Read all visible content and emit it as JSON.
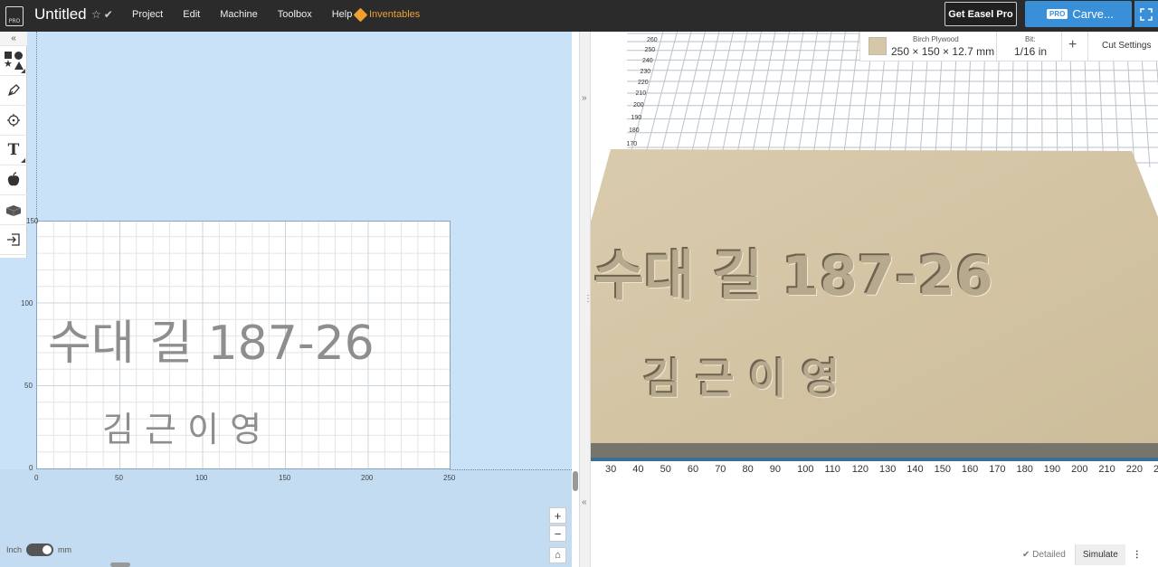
{
  "app": {
    "logo_text": "PRO",
    "title": "Untitled",
    "title_icons": "☆✔"
  },
  "menu": {
    "items": [
      "Project",
      "Edit",
      "Machine",
      "Toolbox",
      "Help"
    ],
    "inventables": "Inventables"
  },
  "actions": {
    "get_pro": "Get Easel Pro",
    "carve_badge": "PRO",
    "carve": "Carve...",
    "expand_icon": "expand-icon"
  },
  "toolbar": {
    "collapse": "«",
    "tools": [
      "shapes-icon",
      "pen-icon",
      "target-icon",
      "text-icon",
      "apple-icon",
      "box-icon",
      "import-icon"
    ],
    "text_tool": "T"
  },
  "canvas": {
    "y_ticks": [
      "150",
      "100",
      "50",
      "0"
    ],
    "x_ticks": [
      "0",
      "50",
      "100",
      "150",
      "200",
      "250"
    ],
    "line1": "수대   길 187-26",
    "line2": "김  근 이  영"
  },
  "units": {
    "left": "Inch",
    "right": "mm"
  },
  "zoom": {
    "in": "+",
    "out": "−",
    "home": "⌂"
  },
  "material": {
    "name": "Birch Plywood",
    "size": "250 × 150 × 12.7 mm",
    "bit_label": "Bit:",
    "bit_value": "1/16 in",
    "add": "+",
    "cut_settings": "Cut Settings"
  },
  "preview": {
    "line1": "수대   길 187-26",
    "line2": "김  근 이  영",
    "y_ticks": [
      "260",
      "250",
      "240",
      "230",
      "220",
      "210",
      "200",
      "190",
      "180",
      "170"
    ],
    "x_ticks": [
      "30",
      "40",
      "50",
      "60",
      "70",
      "80",
      "90",
      "100",
      "110",
      "120",
      "130",
      "140",
      "150",
      "160",
      "170",
      "180",
      "190",
      "200",
      "210",
      "220",
      "2"
    ]
  },
  "bottom": {
    "detailed": "✔ Detailed",
    "simulate": "Simulate",
    "more": "⋮"
  },
  "colors": {
    "topbar": "#2b2b2b",
    "carve": "#3a8fd9",
    "inventables": "#f0a030",
    "design_bg": "#c9e2f8",
    "wood": "#d6c7a8"
  }
}
